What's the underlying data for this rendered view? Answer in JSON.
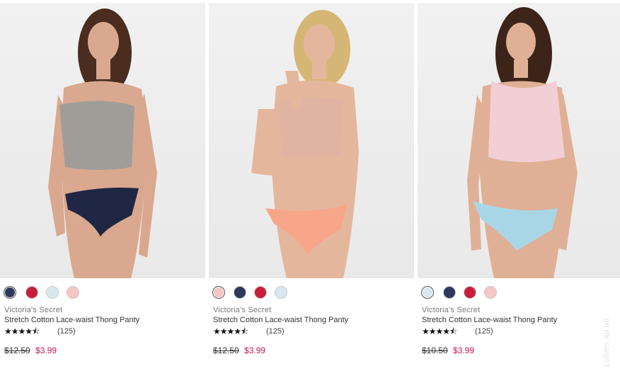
{
  "products": [
    {
      "brand": "Victoria's Secret",
      "name": "Stretch Cotton Lace-waist Thong Panty",
      "stars": "★★★★⯪",
      "reviews": "(125)",
      "old_price": "$12.50",
      "sale_price": "$3.99",
      "rating_value": 4.5,
      "swatches": [
        "#2b3a5c",
        "#c81e3a",
        "#d8e8f0",
        "#f4c7c2"
      ],
      "selected_swatch": 0,
      "colors": {
        "top": "#a09d99",
        "bottom": "#1f2744",
        "skin": "#d9a88f",
        "hair": "#4a2d1e"
      }
    },
    {
      "brand": "Victoria's Secret",
      "name": "Stretch Cotton Lace-waist Thong Panty",
      "stars": "★★★★⯪",
      "reviews": "(125)",
      "old_price": "$12.50",
      "sale_price": "$3.99",
      "rating_value": 4.5,
      "swatches": [
        "#f4c7c2",
        "#2b3a5c",
        "#c81e3a",
        "#d8e8f0"
      ],
      "selected_swatch": 0,
      "colors": {
        "top": "#e0b4a3",
        "bottom": "#f7a68a",
        "skin": "#e4b79d",
        "hair": "#d6b675"
      }
    },
    {
      "brand": "Victoria's Secret",
      "name": "Stretch Cotton Lace-waist Thong Panty",
      "stars": "★★★★⯪",
      "reviews": "(125)",
      "old_price": "$10.50",
      "sale_price": "$3.99",
      "rating_value": 4.5,
      "swatches": [
        "#d8e8f0",
        "#2b3a5c",
        "#c81e3a",
        "#f4c7c2"
      ],
      "selected_swatch": 0,
      "colors": {
        "top": "#f1cfd4",
        "bottom": "#a9d6e6",
        "skin": "#e0b096",
        "hair": "#3c2418"
      }
    }
  ],
  "watermark": "Lubies.ap.ua",
  "accent_sale": "#c2185b"
}
